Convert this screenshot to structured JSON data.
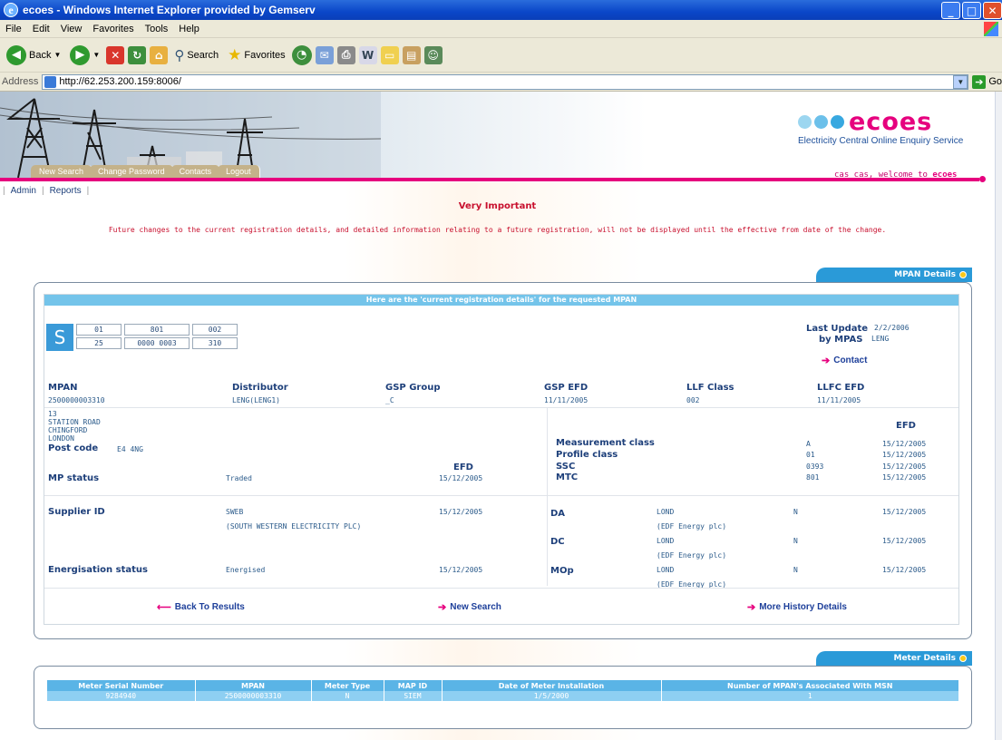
{
  "window": {
    "title": "ecoes - Windows Internet Explorer provided by Gemserv",
    "buttons": {
      "minimize": "_",
      "maximize": "□",
      "close": "✕"
    }
  },
  "menu": [
    "File",
    "Edit",
    "View",
    "Favorites",
    "Tools",
    "Help"
  ],
  "toolbar": {
    "back": "Back",
    "search": "Search",
    "favorites": "Favorites"
  },
  "address": {
    "label": "Address",
    "url": "http://62.253.200.159:8006/",
    "go": "Go"
  },
  "header": {
    "logo": "ecoes",
    "tagline": "Electricity Central Online Enquiry Service",
    "welcome_prefix": "cas cas, welcome to ",
    "welcome_brand": "ecoes",
    "tabs": [
      "New Search",
      "Change Password",
      "Contacts",
      "Logout"
    ]
  },
  "admin_links": [
    "Admin",
    "Reports"
  ],
  "notice": {
    "title": "Very Important",
    "text": "Future changes to the current registration details, and detailed information relating to a future registration, will not be displayed until the effective from date of the change."
  },
  "mpan_section": {
    "tab": "MPAN Details",
    "header": "Here are the 'current registration details' for the requested MPAN",
    "s_letter": "S",
    "s_top": [
      "01",
      "801",
      "002"
    ],
    "s_bottom": [
      "25",
      "0000 0003",
      "310"
    ],
    "last_update_label": "Last Update",
    "last_update_value": "2/2/2006",
    "by_label": "by MPAS",
    "by_value": "LENG",
    "contact": "Contact",
    "summary": [
      {
        "label": "MPAN",
        "value": "2500000003310"
      },
      {
        "label": "Distributor",
        "value": "LENG(LENG1)"
      },
      {
        "label": "GSP Group",
        "value": "_C"
      },
      {
        "label": "GSP EFD",
        "value": "11/11/2005"
      },
      {
        "label": "LLF Class",
        "value": "002"
      },
      {
        "label": "LLFC EFD",
        "value": "11/11/2005"
      }
    ],
    "address": [
      "13",
      "STATION ROAD",
      "CHINGFORD",
      "LONDON"
    ],
    "postcode_label": "Post code",
    "postcode": "E4 4NG",
    "efd_label": "EFD",
    "mp_status": {
      "label": "MP status",
      "value": "Traded",
      "efd": "15/12/2005"
    },
    "supplier": {
      "label": "Supplier ID",
      "value": "SWEB",
      "name": "(SOUTH WESTERN ELECTRICITY PLC)",
      "efd": "15/12/2005"
    },
    "energisation": {
      "label": "Energisation status",
      "value": "Energised",
      "efd": "15/12/2005"
    },
    "classes": [
      {
        "label": "Measurement class",
        "value": "A",
        "efd": "15/12/2005"
      },
      {
        "label": "Profile class",
        "value": "01",
        "efd": "15/12/2005"
      },
      {
        "label": "SSC",
        "value": "0393",
        "efd": "15/12/2005"
      },
      {
        "label": "MTC",
        "value": "801",
        "efd": "15/12/2005"
      }
    ],
    "agents": [
      {
        "label": "DA",
        "id": "LOND",
        "name": "(EDF Energy plc)",
        "flag": "N",
        "efd": "15/12/2005"
      },
      {
        "label": "DC",
        "id": "LOND",
        "name": "(EDF Energy plc)",
        "flag": "N",
        "efd": "15/12/2005"
      },
      {
        "label": "MOp",
        "id": "LOND",
        "name": "(EDF Energy plc)",
        "flag": "N",
        "efd": "15/12/2005"
      }
    ],
    "links": {
      "back": "Back To Results",
      "new_search": "New Search",
      "history": "More History Details"
    }
  },
  "meter_section": {
    "tab": "Meter Details",
    "columns": [
      "Meter Serial Number",
      "MPAN",
      "Meter Type",
      "MAP ID",
      "Date of Meter Installation",
      "Number of MPAN's Associated With MSN"
    ],
    "rows": [
      [
        "9284940",
        "2500000003310",
        "N",
        "SIEM",
        "1/5/2000",
        "1"
      ]
    ]
  },
  "colors": {
    "brand_pink": "#e6007e",
    "accent_blue": "#2a9ad8",
    "notice_red": "#c8102e"
  }
}
